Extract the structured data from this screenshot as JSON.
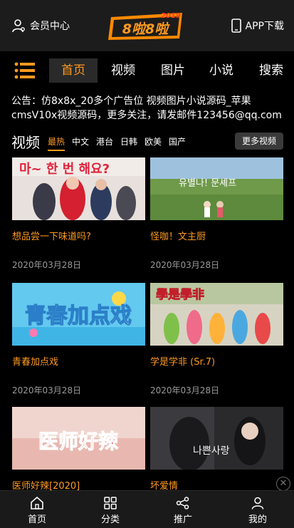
{
  "header": {
    "member_label": "会员中心",
    "app_label": "APP下载",
    "logo_text": "8啦8啦",
    "logo_year": "2019"
  },
  "nav": {
    "tabs": [
      {
        "label": "首页"
      },
      {
        "label": "视频"
      },
      {
        "label": "图片"
      },
      {
        "label": "小说"
      },
      {
        "label": "搜索"
      }
    ]
  },
  "notice": "公告：仿8x8x_20多个广告位 视频图片小说源码_苹果cmsV10x视频源码，更多关注，请发邮件123456@qq.com",
  "section": {
    "title": "视频",
    "categories": [
      "最热",
      "中文",
      "港台",
      "日韩",
      "欧美",
      "国产"
    ],
    "more_label": "更多视频"
  },
  "videos": [
    {
      "title": "想品尝一下味道吗?",
      "date": "2020年03月28日",
      "poster_text": "마~ 한 번 해요?"
    },
    {
      "title": "怪咖！文主厨",
      "date": "2020年03月28日",
      "poster_text": "유별나! 문셰프"
    },
    {
      "title": "青春加点戏",
      "date": "2020年03月28日",
      "poster_text": "青春加点戏"
    },
    {
      "title": "学是学非 (Sr.7)",
      "date": "2020年03月28日",
      "poster_text": "學是學非"
    },
    {
      "title": "医师好辣[2020]",
      "date": "",
      "poster_text": "医师好辣"
    },
    {
      "title": "坏爱情",
      "date": "",
      "poster_text": "나쁜사랑"
    }
  ],
  "tabbar": {
    "items": [
      {
        "label": "首页",
        "icon": "home-icon"
      },
      {
        "label": "分类",
        "icon": "grid-icon"
      },
      {
        "label": "推广",
        "icon": "share-icon"
      },
      {
        "label": "我的",
        "icon": "user-icon"
      }
    ]
  },
  "colors": {
    "accent": "#ff9a1f",
    "background": "#000000",
    "topbar": "#1c1c1c",
    "date_text": "#9a9a9a"
  }
}
